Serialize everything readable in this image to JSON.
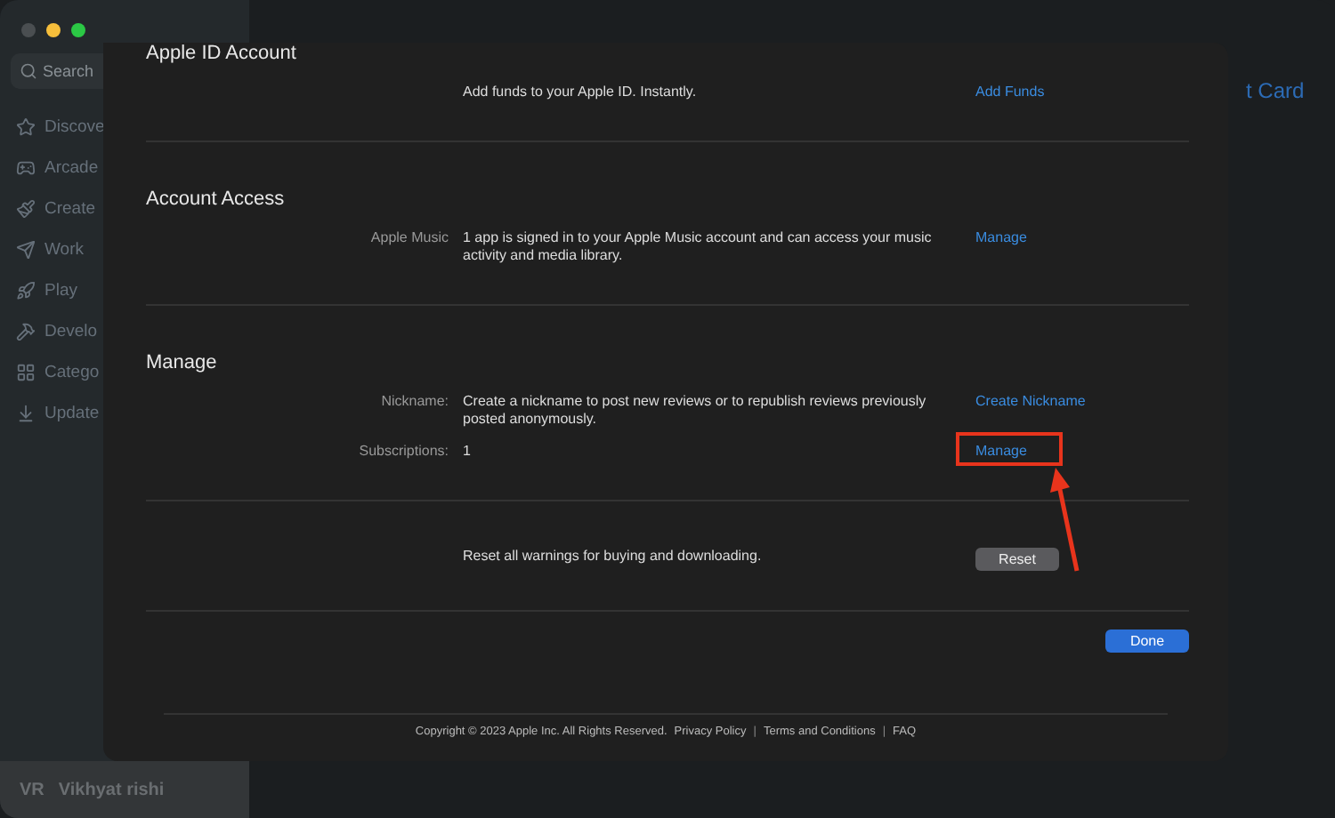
{
  "sidebar": {
    "search": {
      "placeholder": "Search"
    },
    "items": [
      {
        "label": "Discove"
      },
      {
        "label": "Arcade"
      },
      {
        "label": "Create"
      },
      {
        "label": "Work"
      },
      {
        "label": "Play"
      },
      {
        "label": "Develo"
      },
      {
        "label": "Catego"
      },
      {
        "label": "Update"
      }
    ],
    "user": {
      "initials": "VR",
      "name": "Vikhyat rishi"
    }
  },
  "background_link": "t Card",
  "sheet": {
    "sections": [
      {
        "title": "Apple ID Account",
        "rows": [
          {
            "text": "Add funds to your Apple ID. Instantly.",
            "kind": "link",
            "action": "Add Funds",
            "highlighted": false
          }
        ]
      },
      {
        "title": "Account Access",
        "rows": [
          {
            "label": "Apple Music",
            "text": "1 app is signed in to your Apple Music account and can access your music activity and media library.",
            "kind": "link",
            "action": "Manage",
            "highlighted": false
          }
        ]
      },
      {
        "title": "Manage",
        "rows": [
          {
            "label": "Nickname:",
            "text": "Create a nickname to post new reviews or to republish reviews previously posted anonymously.",
            "kind": "link",
            "action": "Create Nickname",
            "highlighted": false
          },
          {
            "label": "Subscriptions:",
            "text": "1",
            "kind": "link",
            "action": "Manage",
            "highlighted": true
          }
        ]
      },
      {
        "rows": [
          {
            "text": "Reset all warnings for buying and downloading.",
            "kind": "button",
            "action": "Reset",
            "highlighted": false
          }
        ]
      }
    ],
    "done": "Done",
    "footer": {
      "copyright": "Copyright © 2023 Apple Inc. All Rights Reserved.",
      "items": [
        {
          "kind": "link",
          "text": "Privacy Policy"
        },
        {
          "kind": "separator",
          "text": "|"
        },
        {
          "kind": "link",
          "text": "Terms and Conditions"
        },
        {
          "kind": "separator",
          "text": "|"
        },
        {
          "kind": "link",
          "text": "FAQ"
        }
      ]
    }
  }
}
